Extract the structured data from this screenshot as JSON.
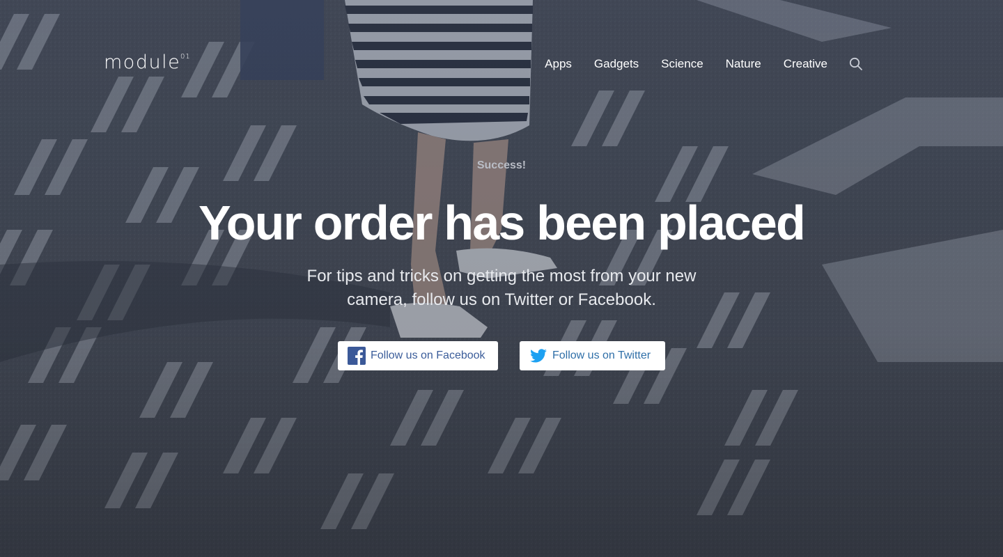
{
  "header": {
    "logo_text": "module",
    "logo_superscript": "01",
    "nav_items": [
      {
        "label": "Apps"
      },
      {
        "label": "Gadgets"
      },
      {
        "label": "Science"
      },
      {
        "label": "Nature"
      },
      {
        "label": "Creative"
      }
    ],
    "search_icon": "search-icon"
  },
  "hero": {
    "eyebrow": "Success!",
    "headline": "Your order has been placed",
    "subtext": "For tips and tricks on getting the most from your new camera, follow us on Twitter or Facebook."
  },
  "buttons": {
    "facebook": {
      "label": "Follow us on Facebook",
      "icon": "facebook-icon",
      "color": "#3b5998"
    },
    "twitter": {
      "label": "Follow us on Twitter",
      "icon": "twitter-icon",
      "color": "#1da1f2"
    }
  },
  "colors": {
    "overlay": "#343e54",
    "text_primary": "#ffffff",
    "eyebrow": "#b9bdc6"
  }
}
